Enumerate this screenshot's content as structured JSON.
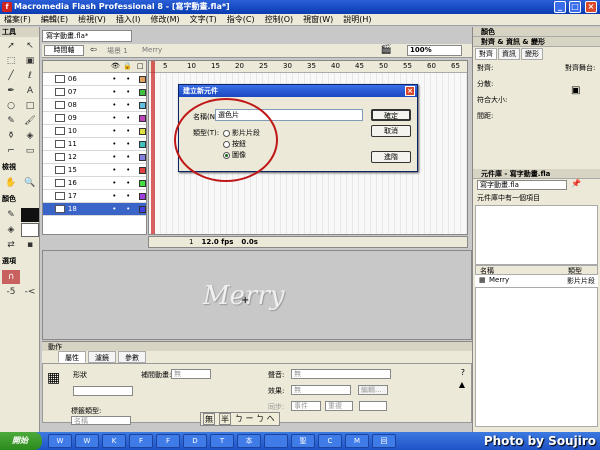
{
  "window": {
    "title": "Macromedia Flash Professional 8 - [寫字動畫.fla*]"
  },
  "menu": [
    "檔案(F)",
    "編輯(E)",
    "檢視(V)",
    "插入(I)",
    "修改(M)",
    "文字(T)",
    "指令(C)",
    "控制(O)",
    "視窗(W)",
    "說明(H)"
  ],
  "tools": {
    "title": "工具",
    "view_label": "檢視",
    "colors_label": "顏色",
    "options_label": "選項"
  },
  "document": {
    "tab": "寫字動畫.fla*",
    "timeline_button": "時間軸",
    "scene": "場景 1",
    "symbol": "Merry",
    "zoom": "100%"
  },
  "timeline": {
    "layers": [
      {
        "name": "06",
        "color": "#e0a060"
      },
      {
        "name": "07",
        "color": "#40c040"
      },
      {
        "name": "08",
        "color": "#60c0e0"
      },
      {
        "name": "09",
        "color": "#c040c0"
      },
      {
        "name": "10",
        "color": "#e0e040"
      },
      {
        "name": "11",
        "color": "#40c0c0"
      },
      {
        "name": "12",
        "color": "#8080e0"
      },
      {
        "name": "15",
        "color": "#e04040"
      },
      {
        "name": "16",
        "color": "#40e040"
      },
      {
        "name": "17",
        "color": "#a040e0"
      },
      {
        "name": "18",
        "color": "#4040e0"
      }
    ],
    "ruler": [
      "5",
      "10",
      "15",
      "20",
      "25",
      "30",
      "35",
      "40",
      "45",
      "50",
      "55",
      "60",
      "65"
    ],
    "current_frame": "1",
    "fps": "12.0 fps",
    "time": "0.0s"
  },
  "stage": {
    "text": "Merry"
  },
  "properties": {
    "header": "動作",
    "tabs": [
      "屬性",
      "濾鏡",
      "參數"
    ],
    "shape_label": "形狀",
    "tween_label": "補間動畫:",
    "tween_value": "無",
    "sound_label": "聲音:",
    "sound_value": "無",
    "effect_label": "效果:",
    "effect_value": "無",
    "edit_button": "編輯...",
    "sync_label": "同步:",
    "sync_value": "事件",
    "repeat_value": "重複",
    "label_type": "標籤類型:",
    "label_type_value": "名稱"
  },
  "right_panel": {
    "color_header": "顏色",
    "align_header": "對齊 & 資訊 & 變形",
    "align_tabs": [
      "對齊",
      "資訊",
      "變形"
    ],
    "align_items": [
      "對齊:",
      "分散:",
      "符合大小:",
      "間距:"
    ],
    "to_stage": "對齊舞台:",
    "library_header": "元件庫 - 寫字動畫.fla",
    "library_doc": "寫字動畫.fla",
    "library_count": "元件庫中有一個項目",
    "lib_col_name": "名稱",
    "lib_col_type": "類型",
    "lib_items": [
      {
        "name": "Merry",
        "type": "影片片段"
      }
    ]
  },
  "dialog": {
    "title": "建立新元件",
    "name_label": "名稱(N):",
    "name_value": "選色片",
    "type_label": "類型(T):",
    "options": [
      "影片片段",
      "按鈕",
      "圖像"
    ],
    "selected": "圖像",
    "ok": "確定",
    "cancel": "取消",
    "advanced": "進階"
  },
  "ime": {
    "a": "無",
    "b": "半",
    "c": "ㄅ ー ㄅ へ"
  },
  "taskbar": {
    "start": "開始",
    "tasks": [
      "W",
      "W",
      "K",
      "F",
      "F",
      "D",
      "T",
      "本",
      "",
      "聖",
      "C",
      "M",
      "回"
    ]
  },
  "watermark": "Photo by Soujiro"
}
